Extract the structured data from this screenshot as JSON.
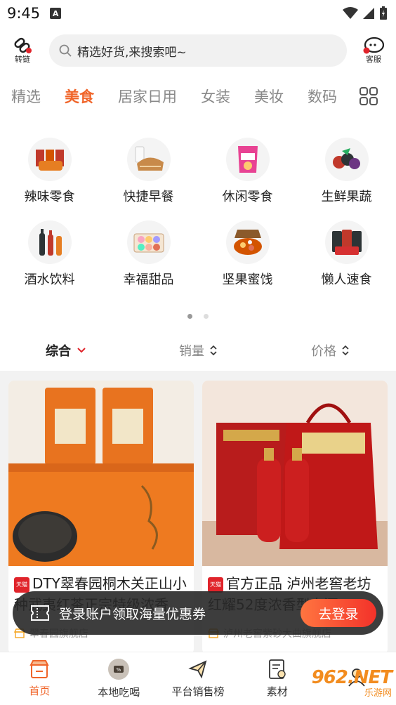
{
  "status": {
    "time": "9:45",
    "a_icon": "A"
  },
  "header": {
    "left_label": "转链",
    "search_placeholder": "精选好货,来搜索吧~",
    "right_label": "客服"
  },
  "category_tabs": [
    "精选",
    "美食",
    "居家日用",
    "女装",
    "美妆",
    "数码"
  ],
  "active_tab": 1,
  "subcategories": [
    {
      "label": "辣味零食",
      "icon": "spicy-snack-icon"
    },
    {
      "label": "快捷早餐",
      "icon": "bread-milk-icon"
    },
    {
      "label": "休闲零食",
      "icon": "chips-bag-icon"
    },
    {
      "label": "生鲜果蔬",
      "icon": "berries-icon"
    },
    {
      "label": "酒水饮料",
      "icon": "bottles-icon"
    },
    {
      "label": "幸福甜品",
      "icon": "macaron-box-icon"
    },
    {
      "label": "坚果蜜饯",
      "icon": "nut-box-icon"
    },
    {
      "label": "懒人速食",
      "icon": "instant-noodle-icon"
    }
  ],
  "sort": {
    "comprehensive": "综合",
    "sales": "销量",
    "price": "价格"
  },
  "products": [
    {
      "badge": "天猫",
      "title": "DTY翠春园桐木关正山小种武夷红茶正宗特级浓香",
      "shop": "翠春园旗舰店"
    },
    {
      "badge": "天猫",
      "title": "官方正品 泸州老窖老坊红耀52度浓香型白酒",
      "shop": "泸州老窖紫砂大曲旗舰店"
    }
  ],
  "toast": {
    "text": "登录账户领取海量优惠券",
    "button": "去登录"
  },
  "bottom_nav": [
    "首页",
    "本地吃喝",
    "平台销售榜",
    "素材",
    ""
  ],
  "watermark": {
    "main": "962.NET",
    "sub": "乐游网"
  },
  "colors": {
    "accent": "#f0652a",
    "tmall_red": "#e0242b"
  }
}
